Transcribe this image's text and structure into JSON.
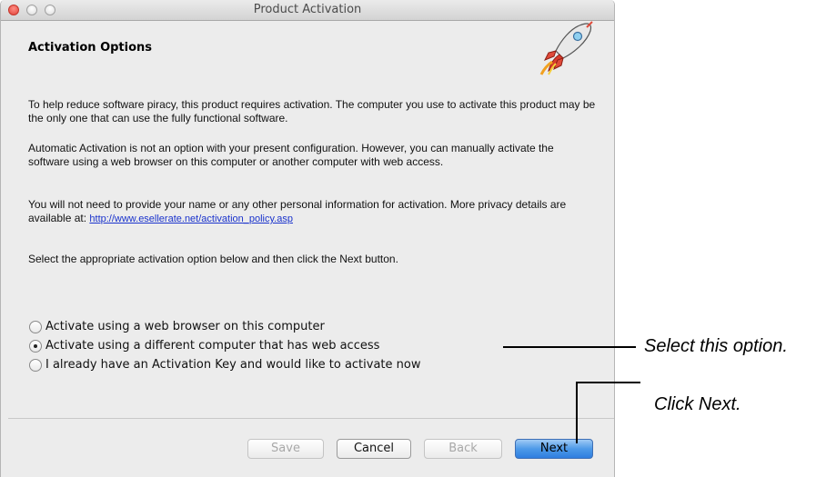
{
  "window": {
    "title": "Product Activation"
  },
  "content": {
    "heading": "Activation Options",
    "paragraphs": [
      "To help reduce software piracy, this product requires activation. The computer you use to activate this product may be the only one that can use the fully functional software.",
      "Automatic Activation is not an option with your present configuration. However, you can manually activate the software using a web browser on this computer or another computer with web access.",
      "You will not need to provide your name or any other personal information for activation. More privacy details are available at:",
      "Select the appropriate activation option below and then click the Next button."
    ],
    "privacy_link": "http://www.esellerate.net/activation_policy.asp",
    "options": [
      {
        "label": "Activate using a web browser on this computer",
        "selected": false
      },
      {
        "label": "Activate using a different computer that has web access",
        "selected": true
      },
      {
        "label": "I already have an Activation Key and would like to activate now",
        "selected": false
      }
    ]
  },
  "buttons": {
    "save": "Save",
    "cancel": "Cancel",
    "back": "Back",
    "next": "Next"
  },
  "annotations": {
    "select_option": "Select this option.",
    "click_next": "Click Next."
  },
  "colors": {
    "link": "#1a33cc",
    "default_button": "#4e9ae8",
    "close_button": "#e0443a"
  },
  "icons": [
    "rocket-icon",
    "radio-button-icon"
  ]
}
